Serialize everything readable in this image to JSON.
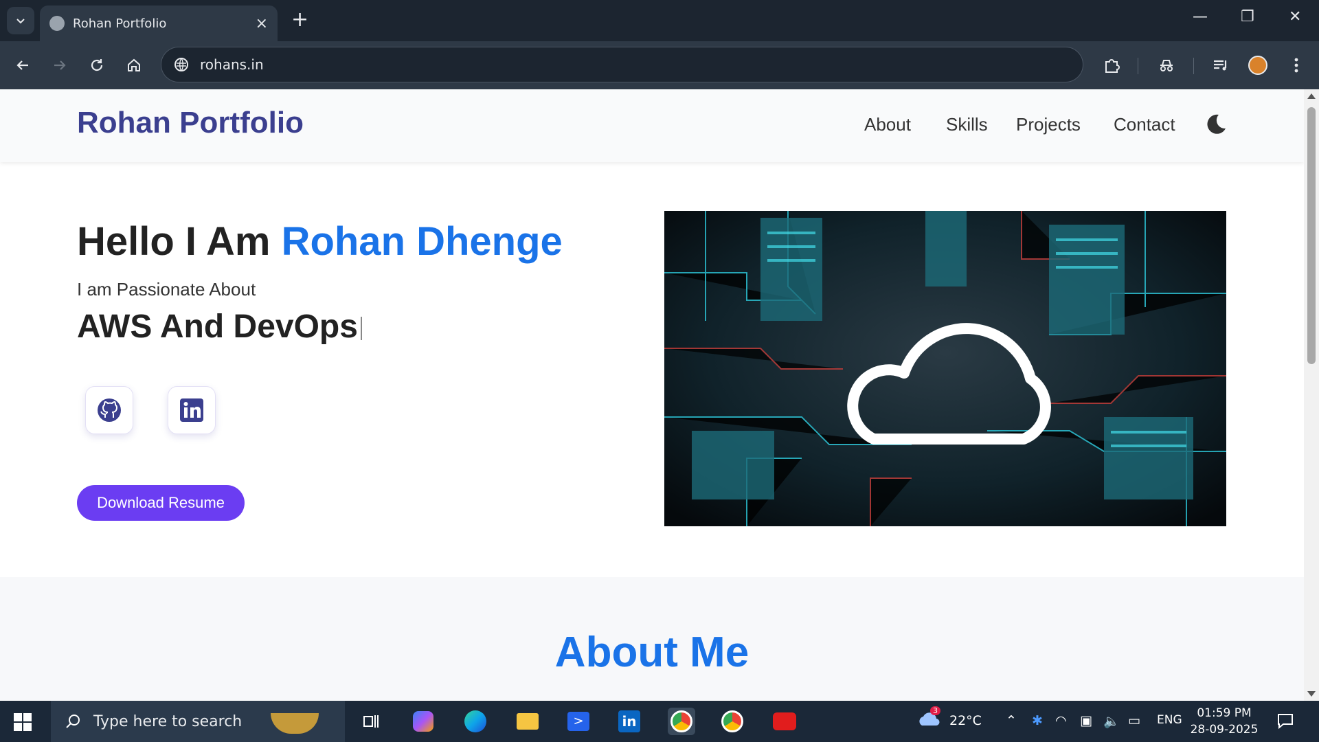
{
  "browser": {
    "tab_title": "Rohan Portfolio",
    "url": "rohans.in"
  },
  "site": {
    "brand": "Rohan Portfolio",
    "nav": [
      "About",
      "Skills",
      "Projects",
      "Contact"
    ],
    "hero": {
      "greeting": "Hello I Am ",
      "name": "Rohan Dhenge",
      "passion_intro": "I am Passionate About",
      "passion_typed": "AWS And DevOps",
      "resume_label": "Download Resume"
    },
    "about_title": "About Me"
  },
  "taskbar": {
    "search_placeholder": "Type here to search",
    "weather_badge": "3",
    "temperature": "22°C",
    "language": "ENG",
    "time": "01:59 PM",
    "date": "28-09-2025"
  },
  "colors": {
    "brand": "#3b3f8f",
    "accent_blue": "#1a73e8",
    "button_purple": "#6b3df2"
  }
}
